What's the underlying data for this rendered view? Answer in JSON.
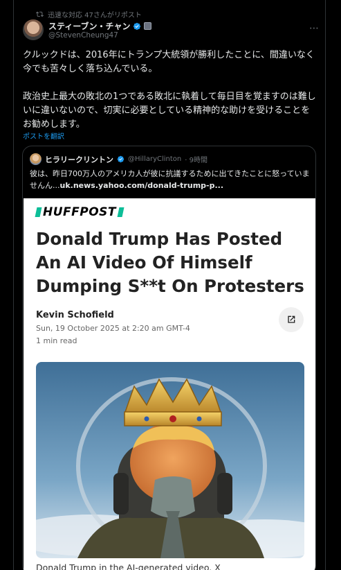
{
  "repost": {
    "text": "迅速な対応 47さんがリポスト",
    "icon": "repost-icon"
  },
  "author": {
    "name": "スティーブン・チャン",
    "handle": "@StevenCheung47",
    "verified_color": "#1d9bf0"
  },
  "post": {
    "text": "クルックドは、2016年にトランプ大統領が勝利したことに、間違いなく今でも苦々しく落ち込んでいる。\n\n政治史上最大の敗北の1つである敗北に執着して毎日目を覚ますのは難しいに違いないので、切実に必要としている精神的な助けを受けることをお勧めします。",
    "translate_label": "ポストを翻訳"
  },
  "quote": {
    "name": "ヒラリークリントン",
    "handle": "@HillaryClinton",
    "time": "· 9時間",
    "text": "彼は、昨日700万人のアメリカ人が彼に抗議するために出てきたことに怒っていませんん...",
    "link": "uk.news.yahoo.com/donald-trump-p..."
  },
  "article": {
    "publisher": "HUFFPOST",
    "headline": "Donald Trump Has Posted An AI Video Of Himself Dumping S**t On Protesters",
    "author": "Kevin Schofield",
    "date": "Sun, 19 October 2025 at 2:20 am GMT-4",
    "read_time": "1 min read",
    "caption": "Donald Trump in the AI-generated video. X",
    "brand_color": "#0dbe98"
  },
  "colors": {
    "background": "#000000",
    "text": "#e7e9ea",
    "muted": "#71767b",
    "accent": "#1d9bf0",
    "border": "#2f3336"
  }
}
